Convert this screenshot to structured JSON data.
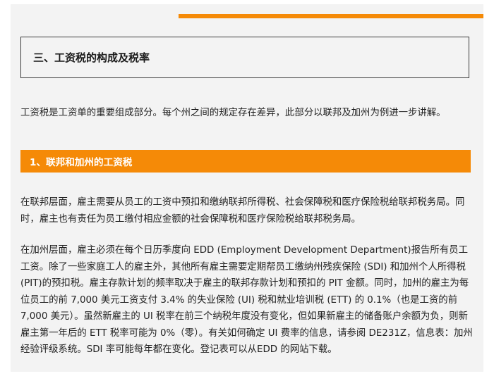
{
  "section": {
    "title": "三、工资税的构成及税率"
  },
  "intro": "工资税是工资单的重要组成部分。每个州之间的规定存在差异，此部分以联邦及加州为例进一步讲解。",
  "subsection": {
    "title": "1、联邦和加州的工资税"
  },
  "paragraphs": {
    "federal": "在联邦层面，雇主需要从员工的工资中预扣和缴纳联邦所得税、社会保障税和医疗保险税给联邦税务局。同时，雇主也有责任为员工缴付相应金额的社会保障税和医疗保险税给联邦税务局。",
    "california": "在加州层面，雇主必须在每个日历季度向 EDD (Employment Development Department)报告所有员工工资。除了一些家庭工人的雇主外，其他所有雇主需要定期帮员工缴纳州残疾保险 (SDI) 和加州个人所得税 (PIT)的预扣税。雇主存款计划的频率取决于雇主的联邦存款计划和预扣的 PIT 金额。同时，加州的雇主为每位员工的前 7,000 美元工资支付 3.4% 的失业保险 (UI) 税和就业培训税 (ETT) 的 0.1%（也是工资的前 7,000 美元）。虽然新雇主的 UI 税率在前三个纳税年度没有变化，但如果新雇主的储备账户余额为负，则新雇主第一年后的 ETT 税率可能为 0%（零）。有关如何确定 UI 费率的信息，请参阅 DE231Z，信息表：加州经验评级系统。SDI 率可能每年都在变化。登记表可以从EDD 的网站下载。"
  },
  "colors": {
    "accent": "#f58a07",
    "panel_bg": "#f3f3f3",
    "text": "#222222"
  }
}
